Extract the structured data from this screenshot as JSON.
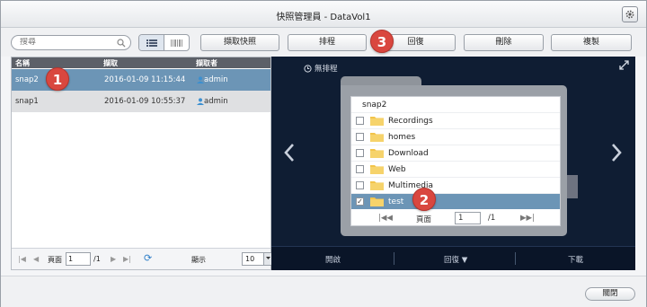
{
  "window": {
    "title": "快照管理員 - DataVol1"
  },
  "toolbar": {
    "search_placeholder": "搜尋",
    "buttons": [
      "擷取快照",
      "排程",
      "回復",
      "刪除",
      "複製"
    ]
  },
  "badges": [
    "1",
    "2",
    "3"
  ],
  "table": {
    "columns": [
      "名稱",
      "擷取",
      "擷取者"
    ],
    "rows": [
      {
        "name": "snap2",
        "time": "2016-01-09 11:15:44",
        "by": "admin",
        "selected": true
      },
      {
        "name": "snap1",
        "time": "2016-01-09 10:55:37",
        "by": "admin",
        "selected": false
      }
    ]
  },
  "pager": {
    "page_label": "頁面",
    "page_value": "1",
    "total": "/1",
    "show_label": "顯示",
    "show_value": "10"
  },
  "preview": {
    "schedule_label": "無排程",
    "snapshot_name": "snap2",
    "folders": [
      {
        "name": "Recordings",
        "checked": false
      },
      {
        "name": "homes",
        "checked": false
      },
      {
        "name": "Download",
        "checked": false
      },
      {
        "name": "Web",
        "checked": false
      },
      {
        "name": "Multimedia",
        "checked": false
      },
      {
        "name": "test",
        "checked": true,
        "selected": true
      }
    ],
    "pager": {
      "page_label": "頁面",
      "page_value": "1",
      "total": "/1"
    },
    "bottom": {
      "open": "開啟",
      "restore": "回復 ▼",
      "download": "下載"
    }
  },
  "footer": {
    "close_label": "關閉"
  },
  "colors": {
    "accent_selected": "#6c95b6",
    "badge": "#d9473f",
    "preview_bg": "#0f1d33"
  }
}
